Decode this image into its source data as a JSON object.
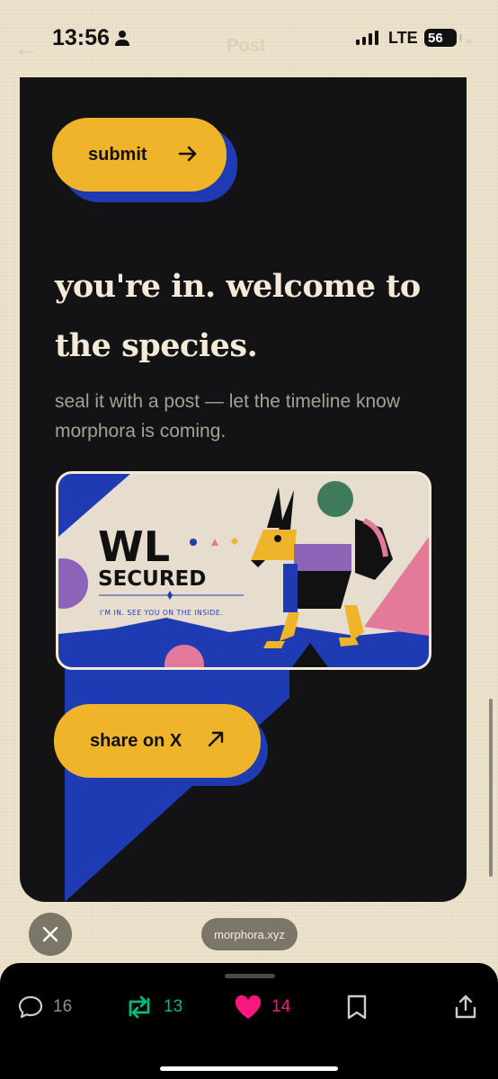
{
  "status_bar": {
    "time": "13:56",
    "network": "LTE",
    "battery": "56",
    "nav_title": "Post"
  },
  "card": {
    "submit_label": "submit",
    "headline_line1": "you're in. welcome to",
    "headline_line2": "the species.",
    "subtitle": "seal it with a post — let the timeline know morphora is coming.",
    "banner": {
      "title_wl": "WL",
      "title_secured": "SECURED",
      "tagline": "I'M IN. SEE YOU ON THE INSIDE."
    },
    "share_label": "share on X"
  },
  "overlay": {
    "url": "morphora.xyz"
  },
  "actions": {
    "replies": "16",
    "reposts": "13",
    "likes": "14"
  },
  "colors": {
    "accent_yellow": "#efb42a",
    "accent_blue": "#1f3bb3",
    "repost_green": "#00ba7c",
    "like_pink": "#f91880",
    "card_bg": "#131214"
  },
  "icons": [
    "person-icon",
    "arrow-right-icon",
    "arrow-up-right-icon",
    "close-icon",
    "reply-icon",
    "repost-icon",
    "heart-icon",
    "bookmark-icon",
    "share-icon"
  ]
}
